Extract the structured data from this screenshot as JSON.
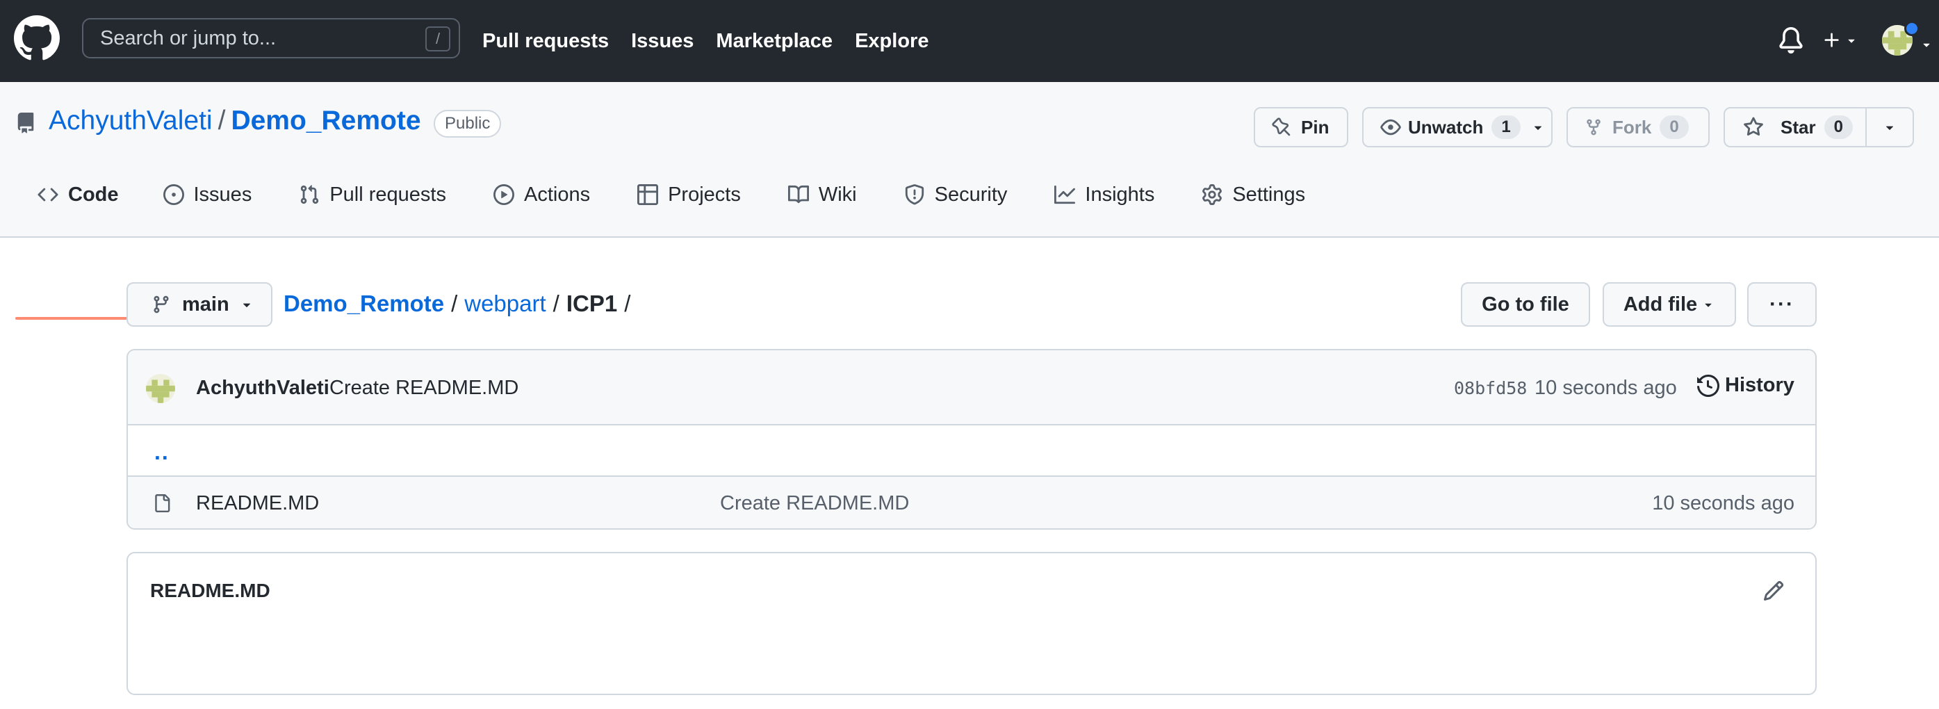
{
  "header": {
    "search_placeholder": "Search or jump to...",
    "search_shortcut": "/",
    "nav": [
      "Pull requests",
      "Issues",
      "Marketplace",
      "Explore"
    ]
  },
  "repo": {
    "owner": "AchyuthValeti",
    "separator": "/",
    "name": "Demo_Remote",
    "visibility": "Public",
    "actions": {
      "pin": "Pin",
      "unwatch": "Unwatch",
      "watch_count": "1",
      "fork": "Fork",
      "fork_count": "0",
      "star": "Star",
      "star_count": "0"
    },
    "tabs": [
      "Code",
      "Issues",
      "Pull requests",
      "Actions",
      "Projects",
      "Wiki",
      "Security",
      "Insights",
      "Settings"
    ]
  },
  "browser": {
    "branch": "main",
    "breadcrumb": {
      "root": "Demo_Remote",
      "folder": "webpart",
      "current": "ICP1",
      "sep": "/"
    },
    "go_to_file": "Go to file",
    "add_file": "Add file",
    "more": "···"
  },
  "commit": {
    "author": "AchyuthValeti",
    "message": "Create README.MD",
    "sha": "08bfd58",
    "time": "10 seconds ago",
    "history": "History"
  },
  "files": {
    "up": "..",
    "rows": [
      {
        "name": "README.MD",
        "message": "Create README.MD",
        "time": "10 seconds ago"
      }
    ]
  },
  "readme": {
    "title": "README.MD"
  },
  "colors": {
    "header_bg": "#24292f",
    "link": "#0969da",
    "tab_underline": "#fd8c73",
    "notification_dot": "#2f81f7"
  }
}
